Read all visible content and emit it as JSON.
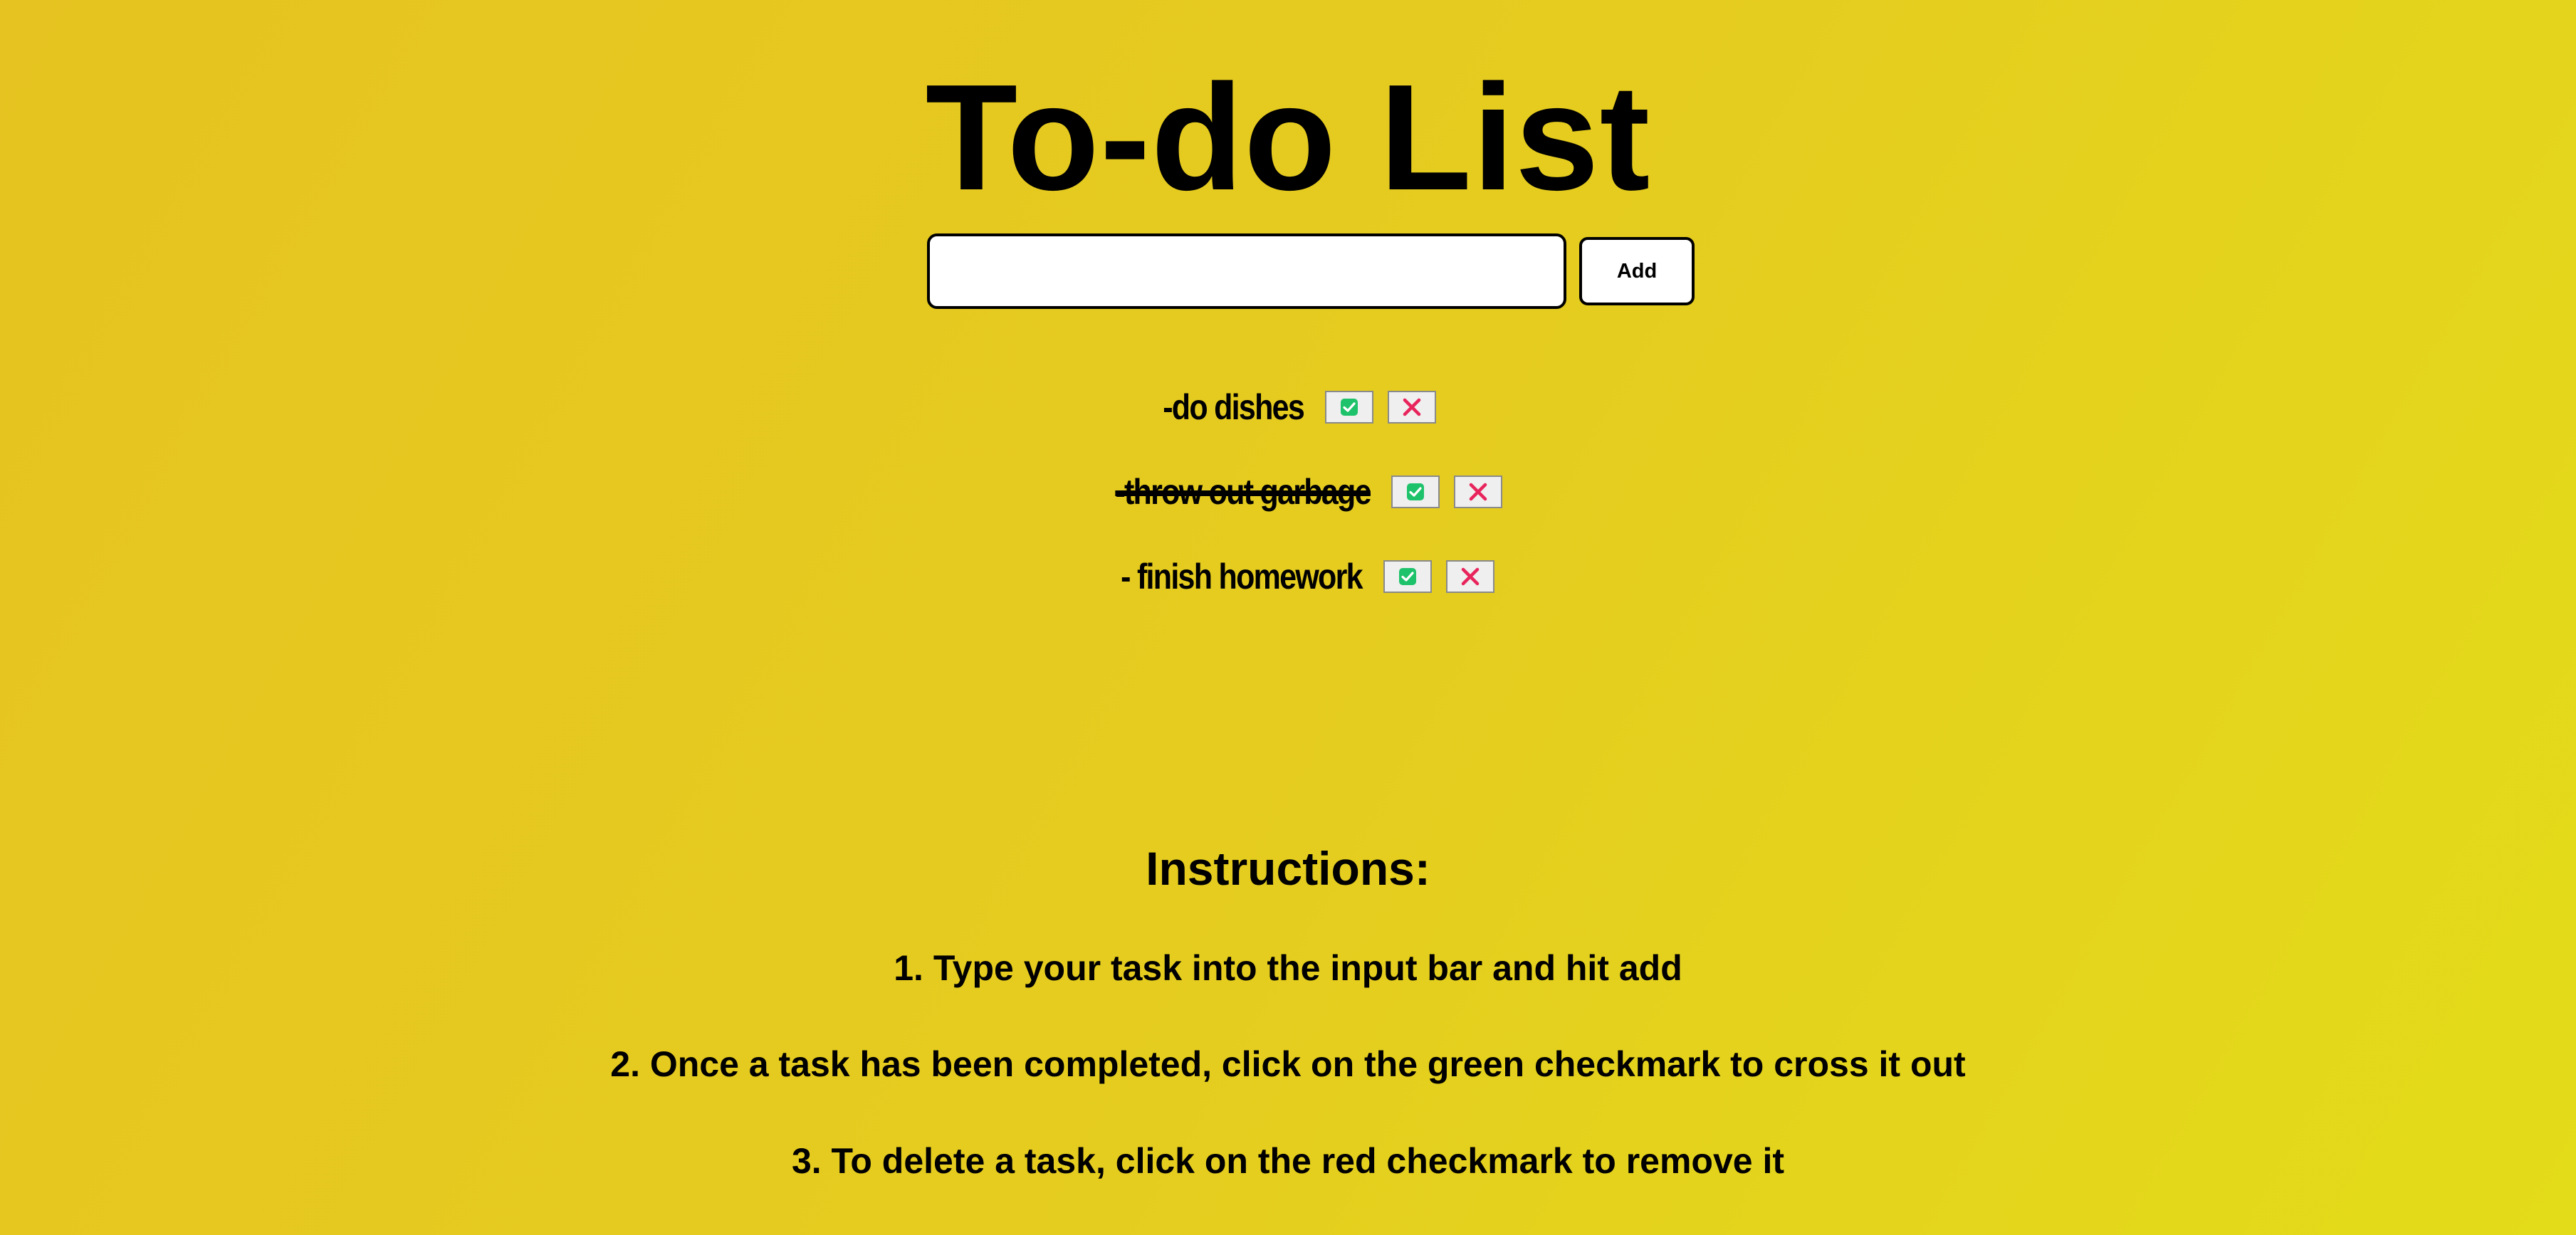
{
  "title": "To-do List",
  "add_form": {
    "input_value": "",
    "input_placeholder": "",
    "add_label": "Add"
  },
  "todos": [
    {
      "text": "-do dishes",
      "completed": false
    },
    {
      "text": "-throw out garbage",
      "completed": true
    },
    {
      "text": "- finish homework",
      "completed": false
    }
  ],
  "icons": {
    "complete": "green-checkmark-icon",
    "delete": "red-x-icon"
  },
  "colors": {
    "complete_icon": "#1ec26a",
    "delete_icon": "#e8245c"
  },
  "instructions": {
    "heading": "Instructions:",
    "steps": [
      "1. Type your task into the input bar and hit add",
      "2. Once a task has been completed, click on the green checkmark to cross it out",
      "3. To delete a task, click on the red checkmark to remove it"
    ]
  }
}
